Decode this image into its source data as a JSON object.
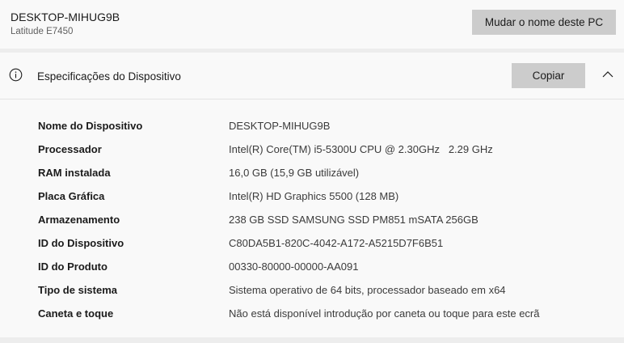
{
  "device_card": {
    "pc_name": "DESKTOP-MIHUG9B",
    "model": "Latitude E7450",
    "rename_label": "Mudar o nome deste PC"
  },
  "specs": {
    "title": "Especificações do Dispositivo",
    "copy_label": "Copiar",
    "info_icon": "info-circle-icon",
    "collapse_icon": "chevron-up-icon",
    "rows": [
      {
        "label": "Nome do Dispositivo",
        "value": "DESKTOP-MIHUG9B"
      },
      {
        "label": "Processador",
        "value": "Intel(R) Core(TM) i5-5300U CPU @ 2.30GHz   2.29 GHz"
      },
      {
        "label": "RAM instalada",
        "value": "16,0 GB (15,9 GB utilizável)"
      },
      {
        "label": "Placa Gráfica",
        "value": "Intel(R) HD Graphics 5500 (128 MB)"
      },
      {
        "label": "Armazenamento",
        "value": "238 GB SSD SAMSUNG SSD PM851 mSATA 256GB"
      },
      {
        "label": "ID do Dispositivo",
        "value": "C80DA5B1-820C-4042-A172-A5215D7F6B51"
      },
      {
        "label": "ID do Produto",
        "value": "00330-80000-00000-AA091"
      },
      {
        "label": "Tipo de sistema",
        "value": "Sistema operativo de 64 bits, processador baseado em x64"
      },
      {
        "label": "Caneta e toque",
        "value": "Não está disponível introdução por caneta ou toque para este ecrã"
      }
    ]
  },
  "colors": {
    "background": "#f3f3f3",
    "card": "#f9f9f9",
    "button": "#cccccc",
    "text": "#1b1b1b",
    "secondary_text": "#5f5f5f"
  }
}
